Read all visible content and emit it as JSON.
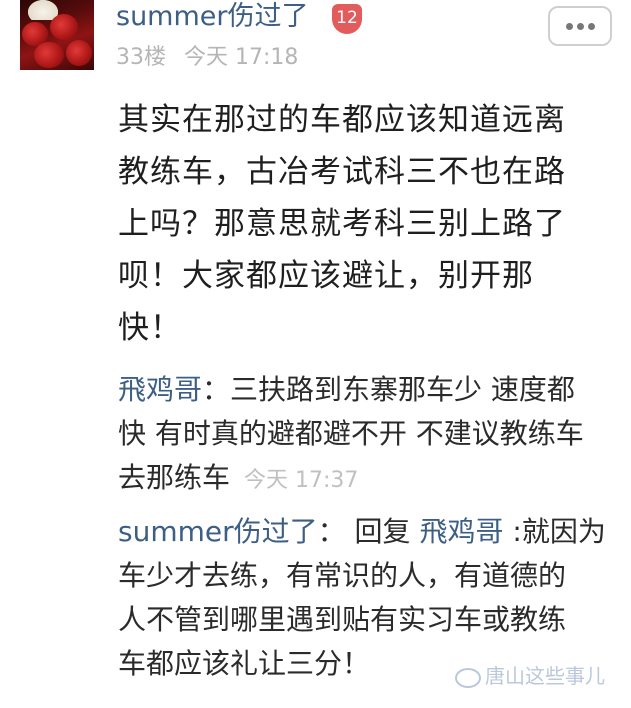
{
  "comment": {
    "username": "summer伤过了",
    "level": "12",
    "floor": "33楼",
    "time": "今天 17:18",
    "content_lines": [
      "其实在那过的车都应该知道远离",
      "教练车，古冶考试科三不也在路",
      "上吗？那意思就考科三别上路了",
      "呗！大家都应该避让，别开那",
      "快！"
    ]
  },
  "replies": [
    {
      "author": "飛鸡哥",
      "separator": "：",
      "lines": [
        "三扶路到东寨那车少 速度都",
        "快 有时真的避都避不开 不建议教练车",
        "去那练车"
      ],
      "time": "今天 17:37"
    },
    {
      "author": "summer伤过了",
      "separator": "：",
      "reply_word": "回复",
      "reply_to": "飛鸡哥",
      "lines": [
        ":就因为",
        "车少才去练，有常识的人，有道德的",
        "人不管到哪里遇到贴有实习车或教练",
        "车都应该礼让三分！"
      ]
    }
  ],
  "watermark": "唐山这些事儿",
  "icons": {
    "more": "more-dots-icon",
    "level_badge": "level-shield-icon",
    "watermark": "wechat-icon"
  },
  "colors": {
    "username": "#3d5f85",
    "badge": "#e25c5c",
    "meta": "#b5b5b5"
  }
}
